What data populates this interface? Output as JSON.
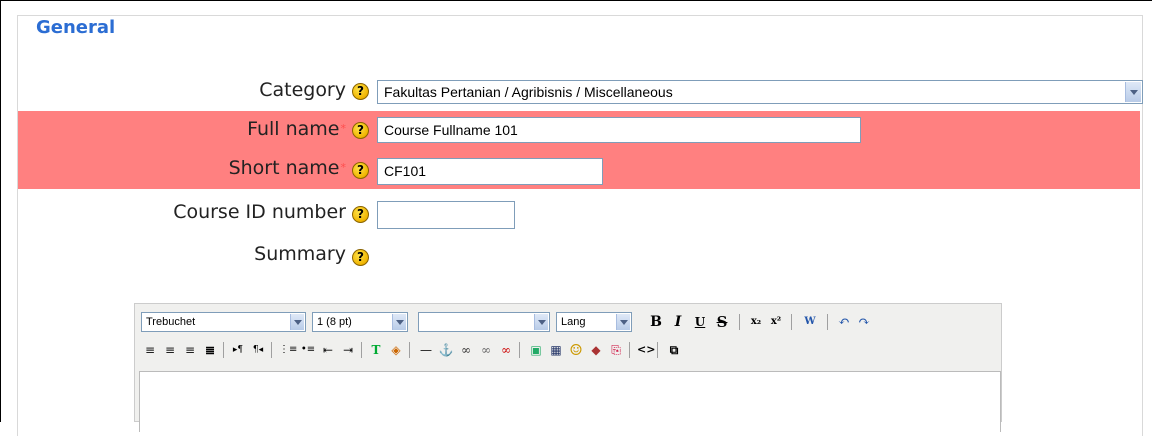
{
  "section": {
    "legend": "General"
  },
  "fields": {
    "category": {
      "label": "Category",
      "value": "Fakultas Pertanian / Agribisnis / Miscellaneous"
    },
    "fullname": {
      "label": "Full name",
      "required_mark": "*",
      "value": "Course Fullname 101"
    },
    "shortname": {
      "label": "Short name",
      "required_mark": "*",
      "value": "CF101"
    },
    "idnumber": {
      "label": "Course ID number",
      "value": ""
    },
    "summary": {
      "label": "Summary"
    }
  },
  "help_glyph": "?",
  "editor": {
    "font_family": "Trebuchet",
    "font_size": "1 (8 pt)",
    "format": "",
    "lang": "Lang",
    "buttons_row1": [
      {
        "name": "bold-icon",
        "glyph": "B"
      },
      {
        "name": "italic-icon",
        "glyph": "I"
      },
      {
        "name": "underline-icon",
        "glyph": "U"
      },
      {
        "name": "strikethrough-icon",
        "glyph": "S"
      },
      {
        "name": "subscript-icon",
        "glyph": "x₂"
      },
      {
        "name": "superscript-icon",
        "glyph": "x²"
      },
      {
        "name": "word-clean-icon",
        "glyph": "W"
      },
      {
        "name": "undo-icon",
        "glyph": "↶"
      },
      {
        "name": "redo-icon",
        "glyph": "↷"
      }
    ],
    "buttons_row2": [
      {
        "name": "align-left-icon",
        "glyph": "≡"
      },
      {
        "name": "align-center-icon",
        "glyph": "≡"
      },
      {
        "name": "align-right-icon",
        "glyph": "≡"
      },
      {
        "name": "align-justify-icon",
        "glyph": "≣"
      },
      {
        "name": "ltr-icon",
        "glyph": "▸¶"
      },
      {
        "name": "rtl-icon",
        "glyph": "¶◂"
      },
      {
        "name": "ordered-list-icon",
        "glyph": "⋮≡"
      },
      {
        "name": "unordered-list-icon",
        "glyph": "•≡"
      },
      {
        "name": "outdent-icon",
        "glyph": "⇤"
      },
      {
        "name": "indent-icon",
        "glyph": "⇥"
      },
      {
        "name": "text-color-icon",
        "glyph": "T"
      },
      {
        "name": "bg-color-icon",
        "glyph": "◈"
      },
      {
        "name": "horizontal-rule-icon",
        "glyph": "—"
      },
      {
        "name": "anchor-icon",
        "glyph": "⚓"
      },
      {
        "name": "link-icon",
        "glyph": "∞"
      },
      {
        "name": "unlink-icon",
        "glyph": "∞"
      },
      {
        "name": "nolink-icon",
        "glyph": "∞"
      },
      {
        "name": "image-icon",
        "glyph": "▣"
      },
      {
        "name": "table-icon",
        "glyph": "▦"
      },
      {
        "name": "smiley-icon",
        "glyph": "☺"
      },
      {
        "name": "special-char-icon",
        "glyph": "◆"
      },
      {
        "name": "search-replace-icon",
        "glyph": "⎘"
      },
      {
        "name": "html-source-icon",
        "glyph": "<>"
      },
      {
        "name": "fullscreen-icon",
        "glyph": "⧉"
      }
    ]
  }
}
